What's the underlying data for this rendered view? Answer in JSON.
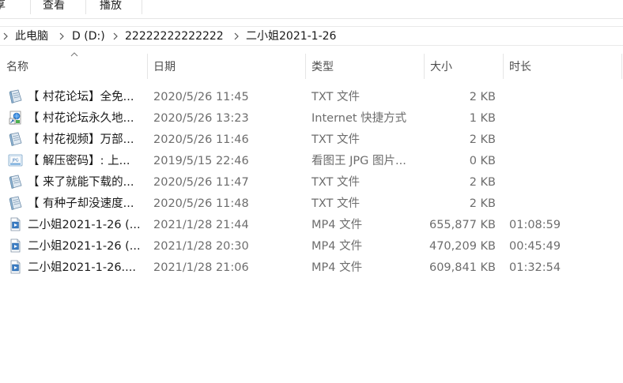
{
  "ribbon": {
    "tabs": [
      "共享",
      "查看",
      "播放"
    ],
    "first_tab_visible": "享"
  },
  "address": {
    "crumbs": [
      "此电脑",
      "D (D:)",
      "22222222222222",
      "二小姐2021-1-26"
    ]
  },
  "columns": {
    "name": "名称",
    "date": "日期",
    "type": "类型",
    "size": "大小",
    "duration": "时长"
  },
  "files": [
    {
      "icon": "text-file-icon",
      "name": "【 村花论坛】全免...",
      "date": "2020/5/26 11:45",
      "type": "TXT 文件",
      "size": "2 KB",
      "duration": ""
    },
    {
      "icon": "internet-shortcut-icon",
      "name": "【 村花论坛永久地...",
      "date": "2020/5/26 13:23",
      "type": "Internet 快捷方式",
      "size": "1 KB",
      "duration": ""
    },
    {
      "icon": "text-file-icon",
      "name": "【 村花视频】万部...",
      "date": "2020/5/26 11:46",
      "type": "TXT 文件",
      "size": "2 KB",
      "duration": ""
    },
    {
      "icon": "image-file-icon",
      "name": "【 解压密码】: 上...",
      "date": "2019/5/15 22:46",
      "type": "看图王 JPG 图片...",
      "size": "0 KB",
      "duration": ""
    },
    {
      "icon": "text-file-icon",
      "name": "【 来了就能下载的...",
      "date": "2020/5/26 11:47",
      "type": "TXT 文件",
      "size": "2 KB",
      "duration": ""
    },
    {
      "icon": "text-file-icon",
      "name": "【 有种子却没速度...",
      "date": "2020/5/26 11:48",
      "type": "TXT 文件",
      "size": "2 KB",
      "duration": ""
    },
    {
      "icon": "video-file-icon",
      "name": "二小姐2021-1-26 (...",
      "date": "2021/1/28 21:44",
      "type": "MP4 文件",
      "size": "655,877 KB",
      "duration": "01:08:59"
    },
    {
      "icon": "video-file-icon",
      "name": "二小姐2021-1-26 (...",
      "date": "2021/1/28 20:30",
      "type": "MP4 文件",
      "size": "470,209 KB",
      "duration": "00:45:49"
    },
    {
      "icon": "video-file-icon",
      "name": "二小姐2021-1-26....",
      "date": "2021/1/28 21:06",
      "type": "MP4 文件",
      "size": "609,841 KB",
      "duration": "01:32:54"
    }
  ]
}
